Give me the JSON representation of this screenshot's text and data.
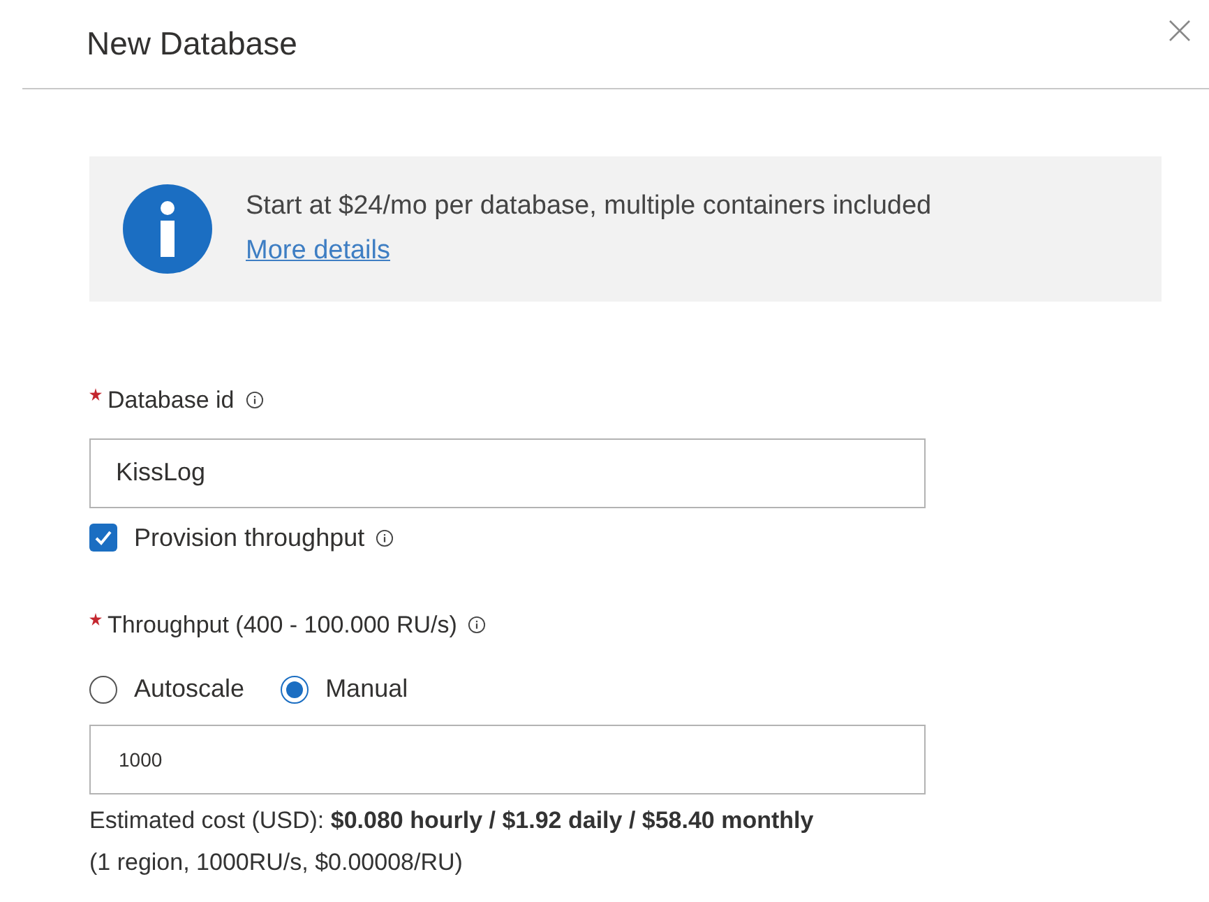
{
  "panel": {
    "title": "New Database"
  },
  "info": {
    "text": "Start at $24/mo per database, multiple containers included",
    "link": "More details"
  },
  "database_id": {
    "label": "Database id",
    "required": true,
    "value": "KissLog"
  },
  "provision_throughput": {
    "label": "Provision throughput",
    "checked": true
  },
  "throughput": {
    "label": "Throughput (400 - 100.000 RU/s)",
    "required": true,
    "modes": [
      {
        "label": "Autoscale",
        "selected": false
      },
      {
        "label": "Manual",
        "selected": true
      }
    ],
    "value": "1000"
  },
  "cost": [
    "Estimated cost (USD): **$0.080 hourly / $1.92 daily / $58.40 monthly**",
    "(1 region, 1000RU/s, $0.00008/RU)"
  ]
}
